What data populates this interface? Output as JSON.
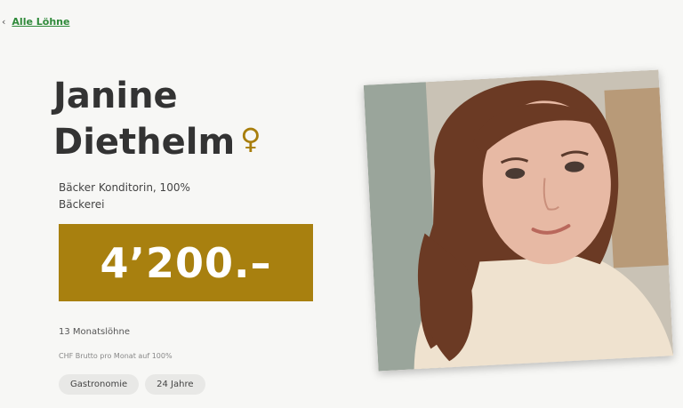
{
  "nav": {
    "back_icon": "chevron-left-icon",
    "back_label": "Alle Löhne"
  },
  "person": {
    "first_name": "Janine",
    "last_name": "Diethelm",
    "gender_symbol": "♀",
    "job_title": "Bäcker Konditorin, 100%",
    "industry": "Bäckerei"
  },
  "salary": {
    "amount": "4’200.–",
    "months": "13 Monatslöhne",
    "note": "CHF Brutto pro Monat auf 100%"
  },
  "tags": [
    "Gastronomie",
    "24 Jahre"
  ],
  "colors": {
    "accent": "#a8800f",
    "link": "#2f8a3a",
    "text": "#333333",
    "tag_bg": "#e8e8e6"
  }
}
